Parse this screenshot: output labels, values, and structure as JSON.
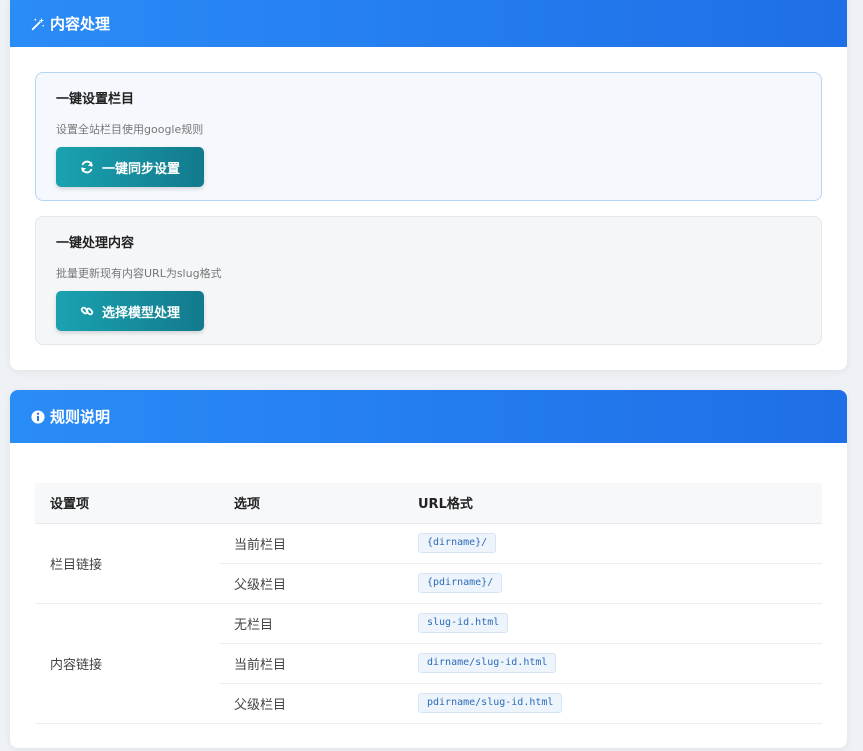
{
  "content_card": {
    "title": "内容处理",
    "icon": "magic-wand-icon",
    "sections": [
      {
        "title": "一键设置栏目",
        "description": "设置全站栏目使用google规则",
        "button_label": "一键同步设置",
        "button_icon": "sync-icon"
      },
      {
        "title": "一键处理内容",
        "description": "批量更新现有内容URL为slug格式",
        "button_label": "选择模型处理",
        "button_icon": "link-icon"
      }
    ]
  },
  "rules_card": {
    "title": "规则说明",
    "icon": "info-circle-icon",
    "table": {
      "headers": [
        "设置项",
        "选项",
        "URL格式"
      ],
      "groups": [
        {
          "label": "栏目链接",
          "rows": [
            {
              "option": "当前栏目",
              "format": "{dirname}/"
            },
            {
              "option": "父级栏目",
              "format": "{pdirname}/"
            }
          ]
        },
        {
          "label": "内容链接",
          "rows": [
            {
              "option": "无栏目",
              "format": "slug-id.html"
            },
            {
              "option": "当前栏目",
              "format": "dirname/slug-id.html"
            },
            {
              "option": "父级栏目",
              "format": "pdirname/slug-id.html"
            }
          ]
        }
      ]
    }
  },
  "colors": {
    "header_gradient_start": "#2a8cf7",
    "header_gradient_end": "#1f6fe6",
    "button_start": "#1aa2b0",
    "button_end": "#127a8c"
  }
}
